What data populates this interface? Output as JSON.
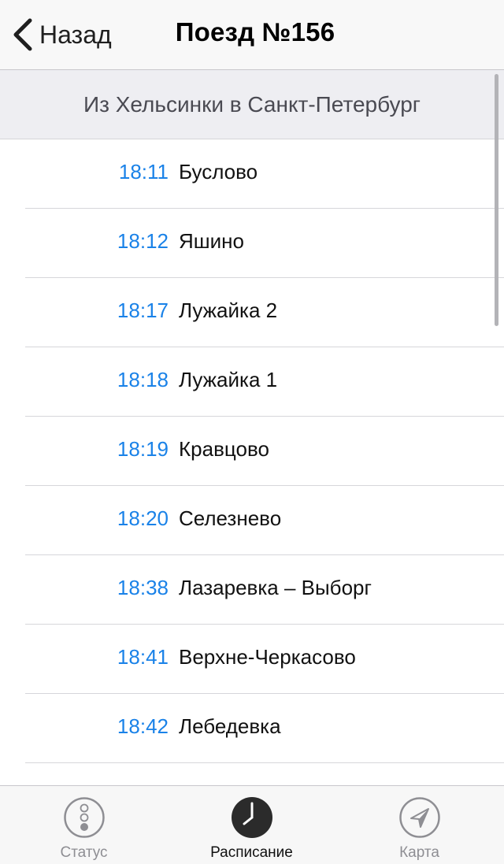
{
  "nav": {
    "back_label": "Назад",
    "title": "Поезд №156"
  },
  "section": {
    "title": "Из Хельсинки в Санкт-Петербург"
  },
  "stops": [
    {
      "time": "18:11",
      "station": "Буслово"
    },
    {
      "time": "18:12",
      "station": "Яшино"
    },
    {
      "time": "18:17",
      "station": "Лужайка 2"
    },
    {
      "time": "18:18",
      "station": "Лужайка 1"
    },
    {
      "time": "18:19",
      "station": "Кравцово"
    },
    {
      "time": "18:20",
      "station": "Селезнево"
    },
    {
      "time": "18:38",
      "station": "Лазаревка – Выборг"
    },
    {
      "time": "18:41",
      "station": "Верхне-Черкасово"
    },
    {
      "time": "18:42",
      "station": "Лебедевка"
    },
    {
      "time": "",
      "station": ""
    }
  ],
  "tabbar": {
    "tabs": [
      {
        "label": "Статус",
        "icon": "traffic-light-icon",
        "active": false
      },
      {
        "label": "Расписание",
        "icon": "clock-icon",
        "active": true
      },
      {
        "label": "Карта",
        "icon": "location-arrow-icon",
        "active": false
      }
    ]
  },
  "colors": {
    "accent_time": "#1a82e8",
    "active_tab_icon": "#2b2b2b",
    "inactive_tab": "#8e8e93"
  }
}
